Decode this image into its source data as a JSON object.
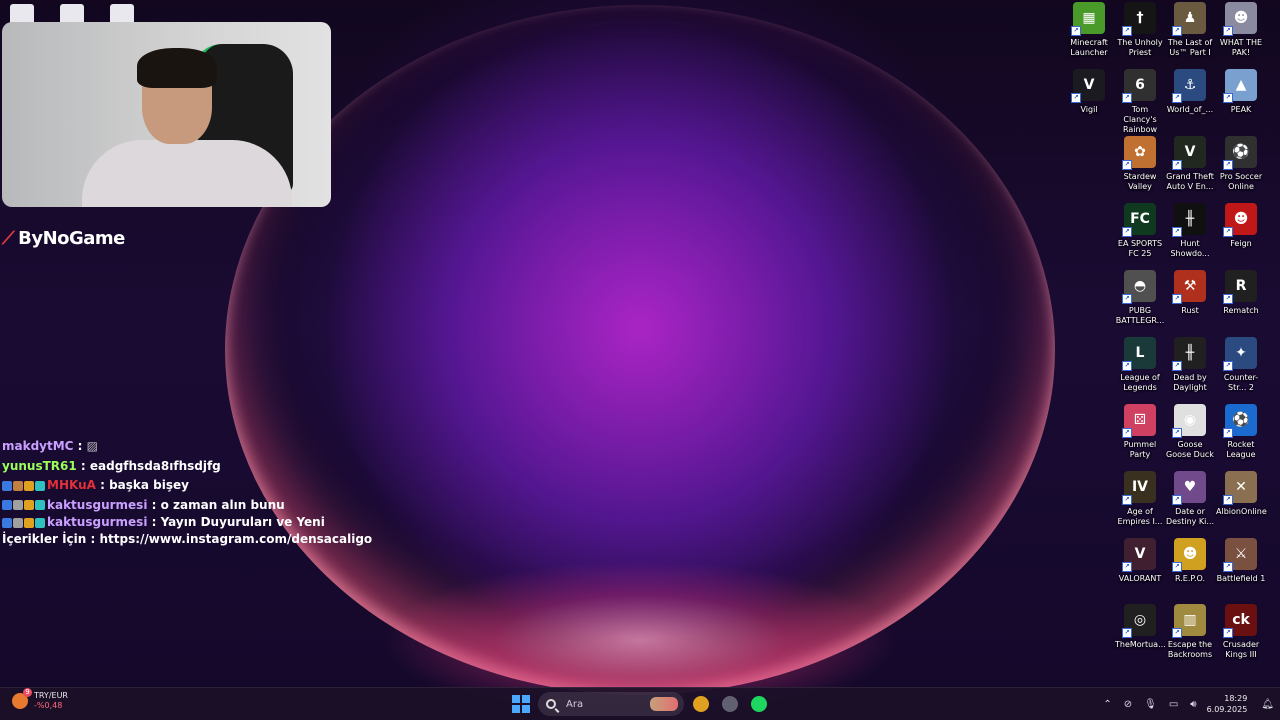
{
  "taskbar_edge_icons": [
    {
      "icon": "app-icon"
    },
    {
      "icon": "file-icon"
    },
    {
      "icon": "file-icon"
    }
  ],
  "overlay": {
    "brand": "ByNoGame"
  },
  "chat": [
    {
      "user": "makdytMC",
      "user_color": "#c9a0ff",
      "message": "",
      "badges": []
    },
    {
      "user": "yunusTR61",
      "user_color": "#9bff5a",
      "message": "eadgfhsda8ıfhsdjfg",
      "badges": []
    },
    {
      "user": "MHKuA",
      "user_color": "#e0303a",
      "message": "başka bişey",
      "badges": [
        "#3a7ae0",
        "#c08040",
        "#e0a020",
        "#30c0c0"
      ]
    },
    {
      "user": "kaktusgurmesi",
      "user_color": "#c9a0ff",
      "message": "o zaman alın bunu",
      "badges": [
        "#3a7ae0",
        "#a0a0a0",
        "#e0a020",
        "#30c0c0"
      ]
    },
    {
      "user": "kaktusgurmesi",
      "user_color": "#c9a0ff",
      "message": "Yayın Duyuruları ve Yeni",
      "badges": [
        "#3a7ae0",
        "#a0a0a0",
        "#e0a020",
        "#30c0c0"
      ]
    },
    {
      "user": "",
      "user_color": "#ffffff",
      "message": "İçerikler İçin : https://www.instagram.com/densacaligo",
      "badges": []
    }
  ],
  "desktop_icons": [
    {
      "label": "Minecraft Launcher",
      "color": "#4a9a2a",
      "glyph": "▦"
    },
    {
      "label": "The Unholy Priest",
      "color": "#151515",
      "glyph": "†"
    },
    {
      "label": "The Last of Us™ Part I",
      "color": "#6a5a40",
      "glyph": "♟"
    },
    {
      "label": "WHAT THE PAK!",
      "color": "#8a8aa0",
      "glyph": "☻"
    },
    {
      "label": "Vigil",
      "color": "#1a1a20",
      "glyph": "V"
    },
    {
      "label": "Tom Clancy's Rainbow Si...",
      "color": "#303030",
      "glyph": "6"
    },
    {
      "label": "World_of_...",
      "color": "#2a4a80",
      "glyph": "⚓"
    },
    {
      "label": "PEAK",
      "color": "#7aa0d0",
      "glyph": "▲"
    },
    {
      "label": "Stardew Valley",
      "color": "#c07030",
      "glyph": "✿"
    },
    {
      "label": "Grand Theft Auto V En...",
      "color": "#202820",
      "glyph": "V"
    },
    {
      "label": "Pro Soccer Online",
      "color": "#303030",
      "glyph": "⚽"
    },
    {
      "label": "EA SPORTS FC 25",
      "color": "#103a20",
      "glyph": "FC"
    },
    {
      "label": "Hunt Showdo...",
      "color": "#101010",
      "glyph": "╫"
    },
    {
      "label": "Feign",
      "color": "#c01818",
      "glyph": "☻"
    },
    {
      "label": "PUBG BATTLEGR...",
      "color": "#505050",
      "glyph": "◓"
    },
    {
      "label": "Rust",
      "color": "#b0301e",
      "glyph": "⚒"
    },
    {
      "label": "Rematch",
      "color": "#202020",
      "glyph": "R"
    },
    {
      "label": "League of Legends",
      "color": "#1a3a3a",
      "glyph": "L"
    },
    {
      "label": "Dead by Daylight",
      "color": "#202020",
      "glyph": "╫"
    },
    {
      "label": "Counter-Str... 2",
      "color": "#2a4a80",
      "glyph": "✦"
    },
    {
      "label": "Pummel Party",
      "color": "#d04060",
      "glyph": "⚄"
    },
    {
      "label": "Goose Goose Duck",
      "color": "#e0e0e0",
      "glyph": "◉"
    },
    {
      "label": "Rocket League",
      "color": "#1a6ad0",
      "glyph": "⚽"
    },
    {
      "label": "Age of Empires I...",
      "color": "#3a3020",
      "glyph": "IV"
    },
    {
      "label": "Date or Destiny Ki...",
      "color": "#704a8a",
      "glyph": "♥"
    },
    {
      "label": "AlbionOnline",
      "color": "#8a7050",
      "glyph": "✕"
    },
    {
      "label": "VALORANT",
      "color": "#402030",
      "glyph": "V"
    },
    {
      "label": "R.E.P.O.",
      "color": "#d0a020",
      "glyph": "☻"
    },
    {
      "label": "Battlefield 1",
      "color": "#7a5040",
      "glyph": "⚔"
    },
    {
      "label": "TheMortua...",
      "color": "#202020",
      "glyph": "◎"
    },
    {
      "label": "Escape the Backrooms",
      "color": "#a08a40",
      "glyph": "▥"
    },
    {
      "label": "Crusader Kings III",
      "color": "#6a1010",
      "glyph": "ck"
    }
  ],
  "taskbar": {
    "weather_currency": "TRY/EUR",
    "weather_change": "-%0,48",
    "weather_badge": "9",
    "search_placeholder": "Ara",
    "apps": [
      {
        "icon": "chrome-icon",
        "color": "#e0a020"
      },
      {
        "icon": "steam-icon",
        "color": "#606070"
      },
      {
        "icon": "spotify-icon",
        "color": "#1ed760"
      }
    ],
    "time": "18:29",
    "date": "6.09.2025"
  }
}
